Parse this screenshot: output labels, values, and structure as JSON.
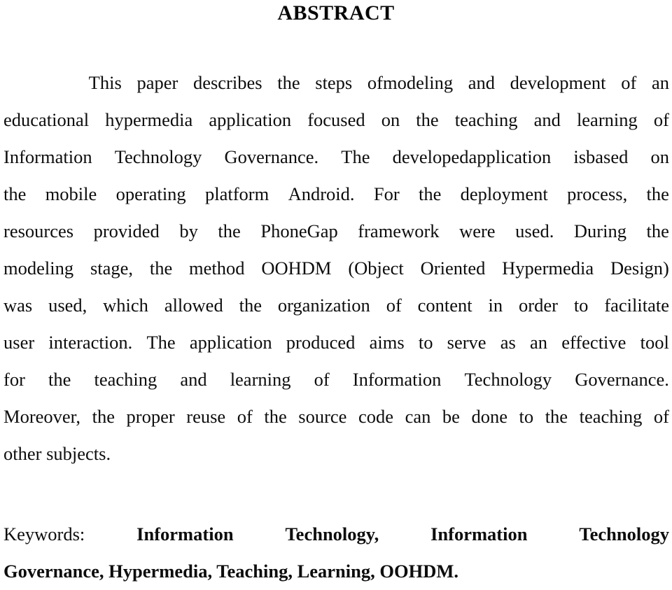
{
  "document": {
    "type": "academic-paper-abstract-page",
    "background_color": "#ffffff",
    "text_color": "#0d0d0d"
  },
  "heading": {
    "text": "ABSTRACT"
  },
  "abstract": {
    "full_text": "This paper describes the steps ofmodeling and development of an educational hypermedia application focused on the teaching and learning of Information Technology Governance. The developedapplication isbased on the mobile operating platform Android. For the deployment process, the resources provided by the PhoneGap framework were used. During the modeling stage, the method OOHDM (Object Oriented Hypermedia Design) was used, which allowed the organization of content in order to facilitate user interaction. The application produced aims to serve as an effective tool for the teaching and learning of Information Technology Governance. Moreover, the proper reuse of the source code can be done to the teaching of other subjects.",
    "lines": [
      "This paper describes the steps ofmodeling and development of an",
      "educational hypermedia application focused on the teaching and learning of",
      "Information Technology Governance. The developedapplication isbased on",
      "the mobile operating platform Android. For the deployment process, the",
      "resources provided by the PhoneGap framework were used. During the",
      "modeling stage, the method OOHDM (Object Oriented Hypermedia Design)",
      "was used, which allowed the organization of content in order to facilitate",
      "user interaction. The application produced aims to serve as an effective tool",
      "for the teaching and learning of Information Technology Governance.",
      "Moreover, the proper reuse of the source code can be done to the teaching of",
      "other subjects."
    ]
  },
  "keywords": {
    "label": "Keywords:",
    "terms": [
      "Information Technology",
      "Information Technology Governance",
      "Hypermedia",
      "Teaching",
      "Learning",
      "OOHDM"
    ],
    "line1_parts": [
      "Keywords:",
      "Information",
      "Technology,",
      "Information",
      "Technology"
    ],
    "line2_text": "Governance, Hypermedia, Teaching, Learning, OOHDM."
  }
}
